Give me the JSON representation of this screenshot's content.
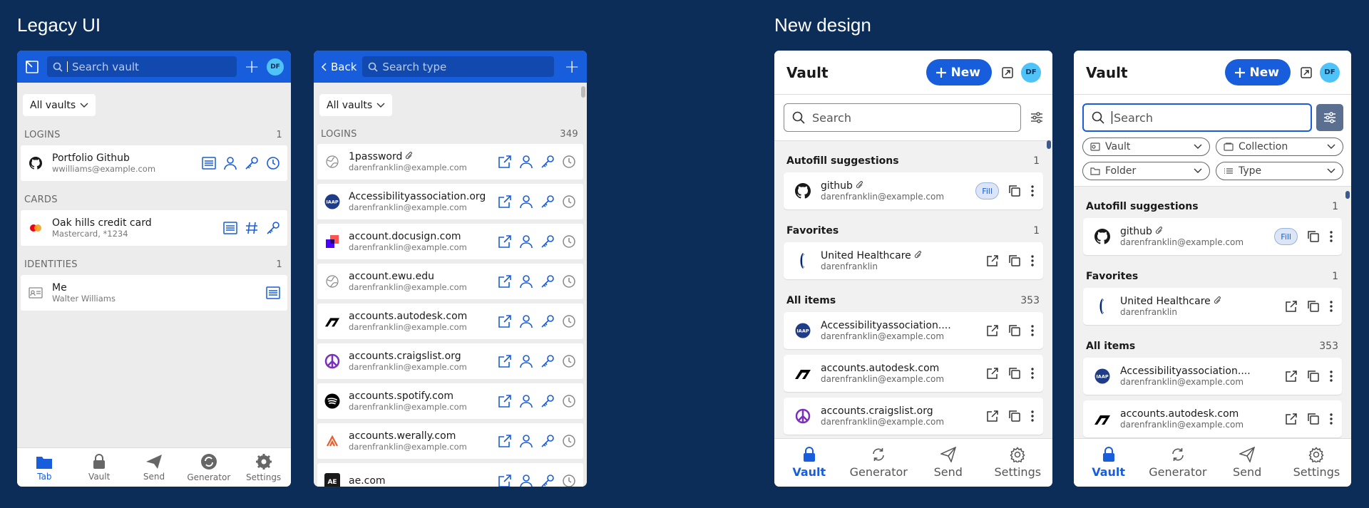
{
  "sections": {
    "legacy": "Legacy UI",
    "new": "New design"
  },
  "colors": {
    "brand": "#175ddc",
    "bg": "#0c2d57",
    "avatar": "#4fc3f7"
  },
  "legacy1": {
    "search_placeholder": "Search vault",
    "avatar": "DF",
    "vault_filter": "All vaults",
    "logins": {
      "label": "LOGINS",
      "count": "1"
    },
    "login_items": [
      {
        "name": "Portfolio Github",
        "sub": "wwilliams@example.com",
        "icon": "github-icon"
      }
    ],
    "cards": {
      "label": "CARDS"
    },
    "card_items": [
      {
        "name": "Oak hills credit card",
        "sub": "Mastercard, *1234",
        "icon": "mastercard-icon"
      }
    ],
    "identities": {
      "label": "IDENTITIES",
      "count": "1"
    },
    "identity_items": [
      {
        "name": "Me",
        "sub": "Walter Williams",
        "icon": "id-card-icon"
      }
    ],
    "tabs": [
      "Tab",
      "Vault",
      "Send",
      "Generator",
      "Settings"
    ]
  },
  "legacy2": {
    "back": "Back",
    "search_placeholder": "Search type",
    "vault_filter": "All vaults",
    "logins": {
      "label": "LOGINS",
      "count": "349"
    },
    "items": [
      {
        "name": "1password",
        "sub": "darenfranklin@example.com",
        "icon": "globe-icon"
      },
      {
        "name": "Accessibilityassociation.org",
        "sub": "darenfranklin@example.com",
        "icon": "iaap-icon"
      },
      {
        "name": "account.docusign.com",
        "sub": "darenfranklin@example.com",
        "icon": "docusign-icon"
      },
      {
        "name": "account.ewu.edu",
        "sub": "darenfranklin@example.com",
        "icon": "globe-icon"
      },
      {
        "name": "accounts.autodesk.com",
        "sub": "darenfranklin@example.com",
        "icon": "autodesk-icon"
      },
      {
        "name": "accounts.craigslist.org",
        "sub": "darenfranklin@example.com",
        "icon": "peace-icon"
      },
      {
        "name": "accounts.spotify.com",
        "sub": "darenfranklin@example.com",
        "icon": "spotify-icon"
      },
      {
        "name": "accounts.werally.com",
        "sub": "darenfranklin@example.com",
        "icon": "rally-icon"
      },
      {
        "name": "ae.com",
        "sub": "",
        "icon": "ae-icon"
      }
    ]
  },
  "new1": {
    "title": "Vault",
    "new_label": "New",
    "avatar": "DF",
    "search_placeholder": "Search",
    "autofill": {
      "label": "Autofill suggestions",
      "count": "1"
    },
    "autofill_items": [
      {
        "name": "github",
        "sub": "darenfranklin@example.com",
        "fill": "Fill"
      }
    ],
    "favorites": {
      "label": "Favorites",
      "count": "1"
    },
    "favorite_items": [
      {
        "name": "United Healthcare",
        "sub": "darenfranklin"
      }
    ],
    "all": {
      "label": "All items",
      "count": "353"
    },
    "all_items": [
      {
        "name": "Accessibilityassociation....",
        "sub": "darenfranklin@example.com"
      },
      {
        "name": "accounts.autodesk.com",
        "sub": "darenfranklin@example.com"
      },
      {
        "name": "accounts.craigslist.org",
        "sub": "darenfranklin@example.com"
      }
    ],
    "tabs": [
      "Vault",
      "Generator",
      "Send",
      "Settings"
    ]
  },
  "new2": {
    "title": "Vault",
    "new_label": "New",
    "avatar": "DF",
    "search_placeholder": "Search",
    "filters": [
      "Vault",
      "Collection",
      "Folder",
      "Type"
    ],
    "autofill": {
      "label": "Autofill suggestions",
      "count": "1"
    },
    "autofill_items": [
      {
        "name": "github",
        "sub": "darenfranklin@example.com",
        "fill": "Fill"
      }
    ],
    "favorites": {
      "label": "Favorites",
      "count": "1"
    },
    "favorite_items": [
      {
        "name": "United Healthcare",
        "sub": "darenfranklin"
      }
    ],
    "all": {
      "label": "All items",
      "count": "353"
    },
    "all_items": [
      {
        "name": "Accessibilityassociation....",
        "sub": "darenfranklin@example.com"
      },
      {
        "name": "accounts.autodesk.com",
        "sub": "darenfranklin@example.com"
      }
    ],
    "tabs": [
      "Vault",
      "Generator",
      "Send",
      "Settings"
    ]
  }
}
